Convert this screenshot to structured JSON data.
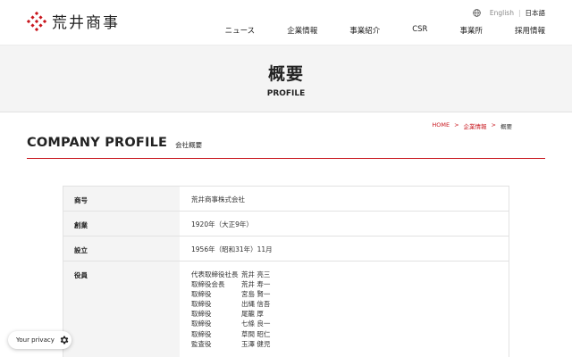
{
  "header": {
    "logo_text": "荒井商事",
    "lang": {
      "english": "English",
      "separator": "|",
      "japanese": "日本語"
    },
    "nav": [
      "ニュース",
      "企業情報",
      "事業紹介",
      "CSR",
      "事業所",
      "採用情報"
    ]
  },
  "hero": {
    "title_ja": "概要",
    "title_en": "PROFILE"
  },
  "breadcrumb": {
    "home": "HOME",
    "sep": ">",
    "parent": "企業情報",
    "current": "概要"
  },
  "section": {
    "title_en": "COMPANY PROFILE",
    "title_ja": "会社概要"
  },
  "profile": {
    "rows": [
      {
        "label": "商号",
        "value": "荒井商事株式会社"
      },
      {
        "label": "創業",
        "value": "1920年（大正9年）"
      },
      {
        "label": "設立",
        "value": "1956年（昭和31年）11月"
      }
    ],
    "officers_label": "役員",
    "officers": [
      {
        "role": "代表取締役社長",
        "name": "荒井 亮三"
      },
      {
        "role": "取締役会長",
        "name": "荒井 寿一"
      },
      {
        "role": "取締役",
        "name": "宮島 賢一"
      },
      {
        "role": "取締役",
        "name": "出縄 信吾"
      },
      {
        "role": "取締役",
        "name": "尾籠 厚"
      },
      {
        "role": "取締役",
        "name": "七條 良一"
      },
      {
        "role": "取締役",
        "name": "草間 昭仁"
      },
      {
        "role": "監査役",
        "name": "玉澤 健児"
      }
    ]
  },
  "privacy": {
    "label": "Your privacy"
  },
  "colors": {
    "accent": "#c8161d",
    "hero_bg": "#f4f4f4",
    "table_header_bg": "#f4f4f4"
  }
}
